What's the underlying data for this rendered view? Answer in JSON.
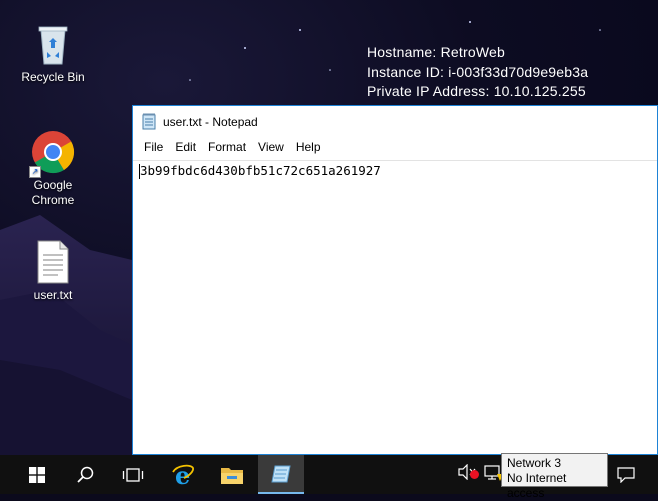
{
  "desktop": {
    "icons": [
      {
        "label": "Recycle Bin"
      },
      {
        "label": "Google Chrome"
      },
      {
        "label": "user.txt"
      }
    ],
    "sysinfo": {
      "hostname": "Hostname: RetroWeb",
      "instance_id": "Instance ID: i-003f33d70d9e9eb3a",
      "private_ip": "Private IP Address: 10.10.125.255"
    }
  },
  "notepad": {
    "title": "user.txt - Notepad",
    "menu": [
      "File",
      "Edit",
      "Format",
      "View",
      "Help"
    ],
    "content": "3b99fbdc6d430bfb51c72c651a261927"
  },
  "taskbar": {
    "buttons": [
      {
        "icon": "windows-start-icon"
      },
      {
        "icon": "search-icon"
      },
      {
        "icon": "task-view-icon"
      },
      {
        "icon": "internet-explorer-icon"
      },
      {
        "icon": "file-explorer-icon"
      },
      {
        "icon": "notepad-icon",
        "active": true
      }
    ],
    "tray": {
      "volume_icon": "volume-muted-icon",
      "network_icon": "network-warning-icon",
      "notification_icon": "action-center-icon"
    },
    "network_tooltip": {
      "line1": "Network  3",
      "line2": "No Internet access"
    }
  },
  "colors": {
    "accent": "#1e83d6",
    "taskbar": "#101010",
    "desktop": "#0d0c22"
  }
}
